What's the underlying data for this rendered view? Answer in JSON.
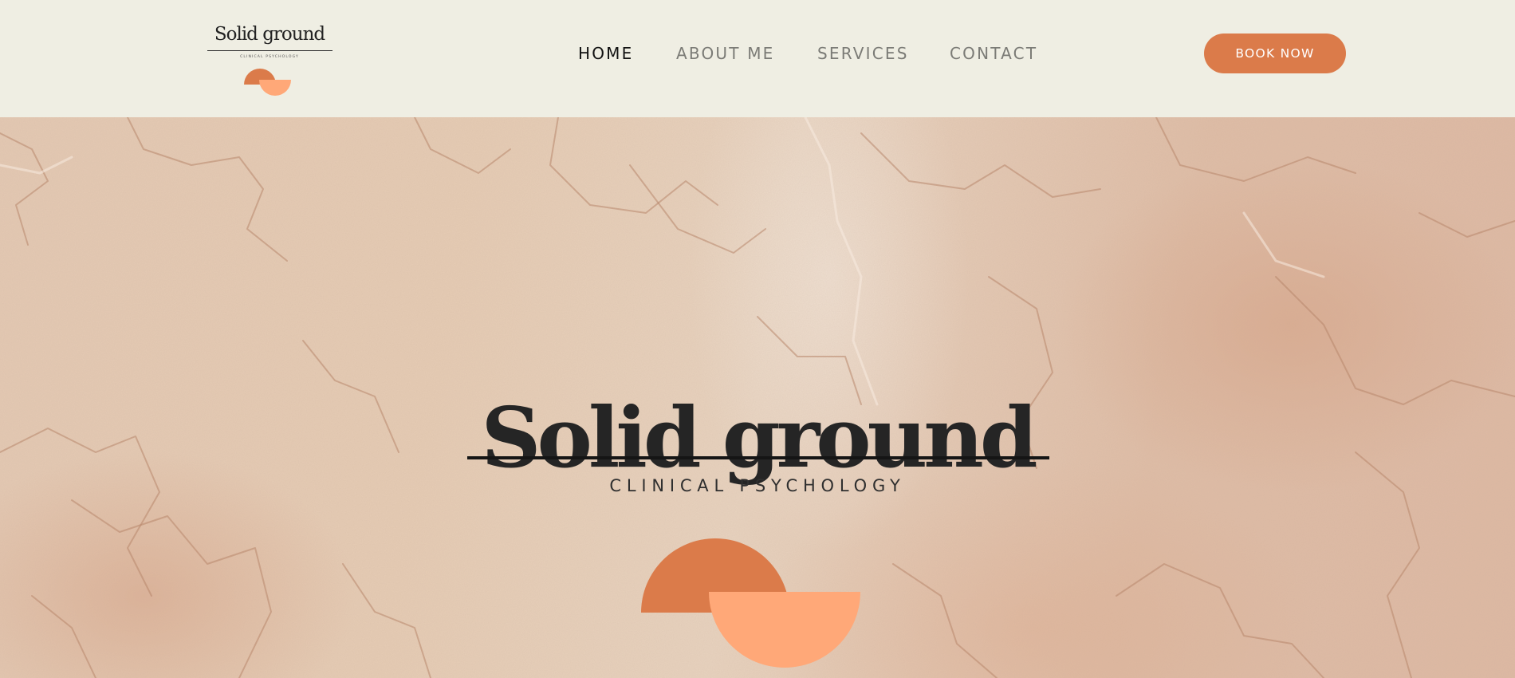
{
  "brand": {
    "wordmark": "Solid ground",
    "tagline": "CLINICAL PSYCHOLOGY",
    "accent_dark": "#db7b4a",
    "accent_light": "#ffa878"
  },
  "nav": {
    "items": [
      {
        "label": "HOME",
        "active": true
      },
      {
        "label": "ABOUT ME",
        "active": false
      },
      {
        "label": "SERVICES",
        "active": false
      },
      {
        "label": "CONTACT",
        "active": false
      }
    ]
  },
  "cta": {
    "label": "BOOK NOW",
    "color": "#db7b4a"
  },
  "hero": {
    "title": "Solid ground",
    "subtitle": "CLINICAL PSYCHOLOGY",
    "background": "textured sandstone"
  },
  "colors": {
    "header_bg": "#efeee3",
    "text_dark": "#111111",
    "text_muted": "#7b7b76"
  }
}
